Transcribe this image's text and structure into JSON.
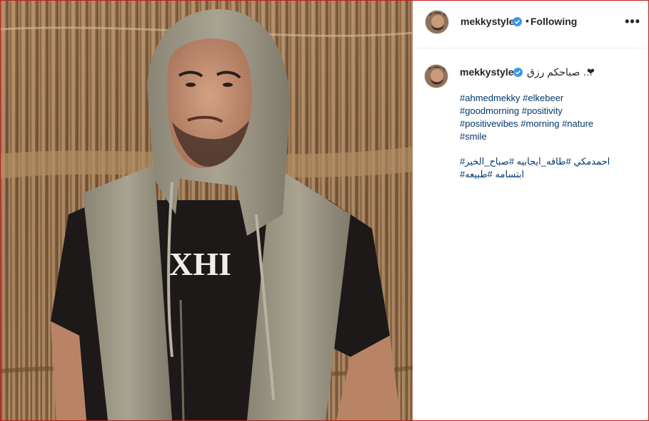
{
  "post": {
    "username": "mekkystyle",
    "follow_status": "Following",
    "separator": "•",
    "more_icon": "more-options-icon",
    "caption_text": "صباحكم رزق …",
    "caption_emoji": "❤",
    "hashtags_en": [
      "#ahmedmekky #elkebeer",
      "#goodmorning #positivity",
      "#positivevibes #morning #nature",
      "#smile"
    ],
    "hashtags_ar": [
      "احمدمكي #طاقه_ايجابيه #صباح_الخير#",
      "ابتسامه #طبيعه#"
    ]
  },
  "colors": {
    "verified_blue": "#3897f0",
    "hashtag_blue": "#00376b",
    "frame_border": "#b9201c"
  }
}
